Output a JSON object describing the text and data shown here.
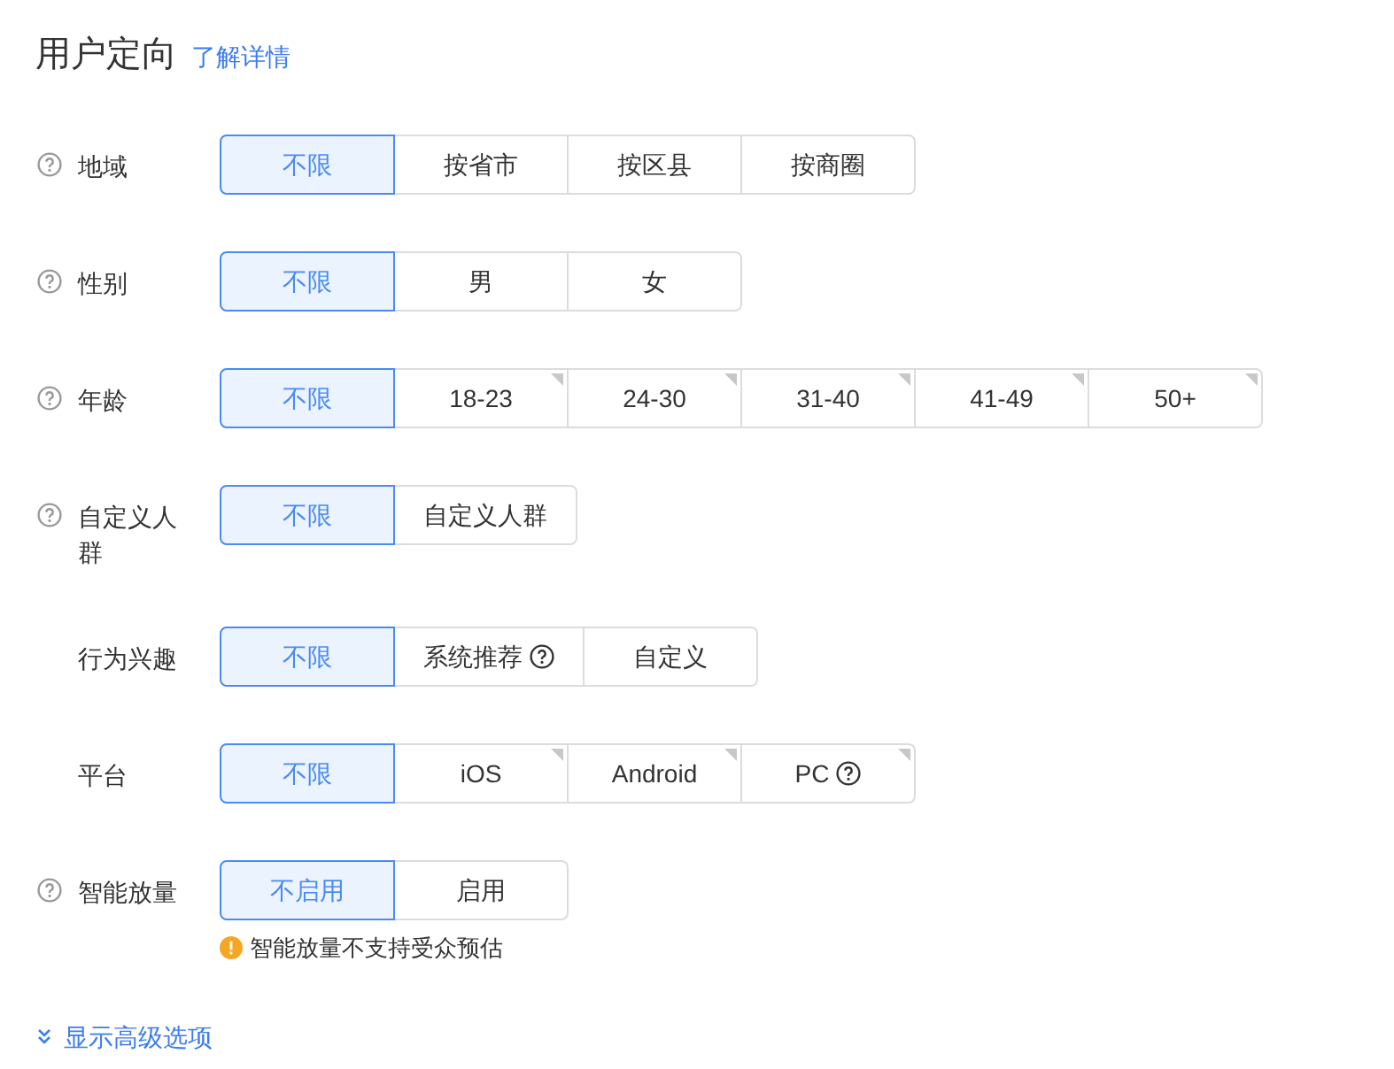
{
  "title": "用户定向",
  "details_link": "了解详情",
  "rows": [
    {
      "label": "地域",
      "help": true,
      "options": [
        {
          "label": "不限",
          "selected": true,
          "corner": false,
          "help": false
        },
        {
          "label": "按省市",
          "selected": false,
          "corner": false,
          "help": false
        },
        {
          "label": "按区县",
          "selected": false,
          "corner": false,
          "help": false
        },
        {
          "label": "按商圈",
          "selected": false,
          "corner": false,
          "help": false
        }
      ]
    },
    {
      "label": "性别",
      "help": true,
      "options": [
        {
          "label": "不限",
          "selected": true,
          "corner": false,
          "help": false
        },
        {
          "label": "男",
          "selected": false,
          "corner": false,
          "help": false
        },
        {
          "label": "女",
          "selected": false,
          "corner": false,
          "help": false
        }
      ]
    },
    {
      "label": "年龄",
      "help": true,
      "options": [
        {
          "label": "不限",
          "selected": true,
          "corner": false,
          "help": false
        },
        {
          "label": "18-23",
          "selected": false,
          "corner": true,
          "help": false
        },
        {
          "label": "24-30",
          "selected": false,
          "corner": true,
          "help": false
        },
        {
          "label": "31-40",
          "selected": false,
          "corner": true,
          "help": false
        },
        {
          "label": "41-49",
          "selected": false,
          "corner": true,
          "help": false
        },
        {
          "label": "50+",
          "selected": false,
          "corner": true,
          "help": false
        }
      ]
    },
    {
      "label": "自定义人群",
      "help": true,
      "options": [
        {
          "label": "不限",
          "selected": true,
          "corner": false,
          "help": false
        },
        {
          "label": "自定义人群",
          "selected": false,
          "corner": false,
          "help": false
        }
      ]
    },
    {
      "label": "行为兴趣",
      "help": false,
      "options": [
        {
          "label": "不限",
          "selected": true,
          "corner": false,
          "help": false
        },
        {
          "label": "系统推荐",
          "selected": false,
          "corner": false,
          "help": true
        },
        {
          "label": "自定义",
          "selected": false,
          "corner": false,
          "help": false
        }
      ]
    },
    {
      "label": "平台",
      "help": false,
      "options": [
        {
          "label": "不限",
          "selected": true,
          "corner": false,
          "help": false
        },
        {
          "label": "iOS",
          "selected": false,
          "corner": true,
          "help": false
        },
        {
          "label": "Android",
          "selected": false,
          "corner": true,
          "help": false
        },
        {
          "label": "PC",
          "selected": false,
          "corner": true,
          "help": true
        }
      ]
    },
    {
      "label": "智能放量",
      "help": true,
      "note": "智能放量不支持受众预估",
      "options": [
        {
          "label": "不启用",
          "selected": true,
          "corner": false,
          "help": false
        },
        {
          "label": "启用",
          "selected": false,
          "corner": false,
          "help": false
        }
      ]
    }
  ],
  "advanced_link": "显示高级选项"
}
